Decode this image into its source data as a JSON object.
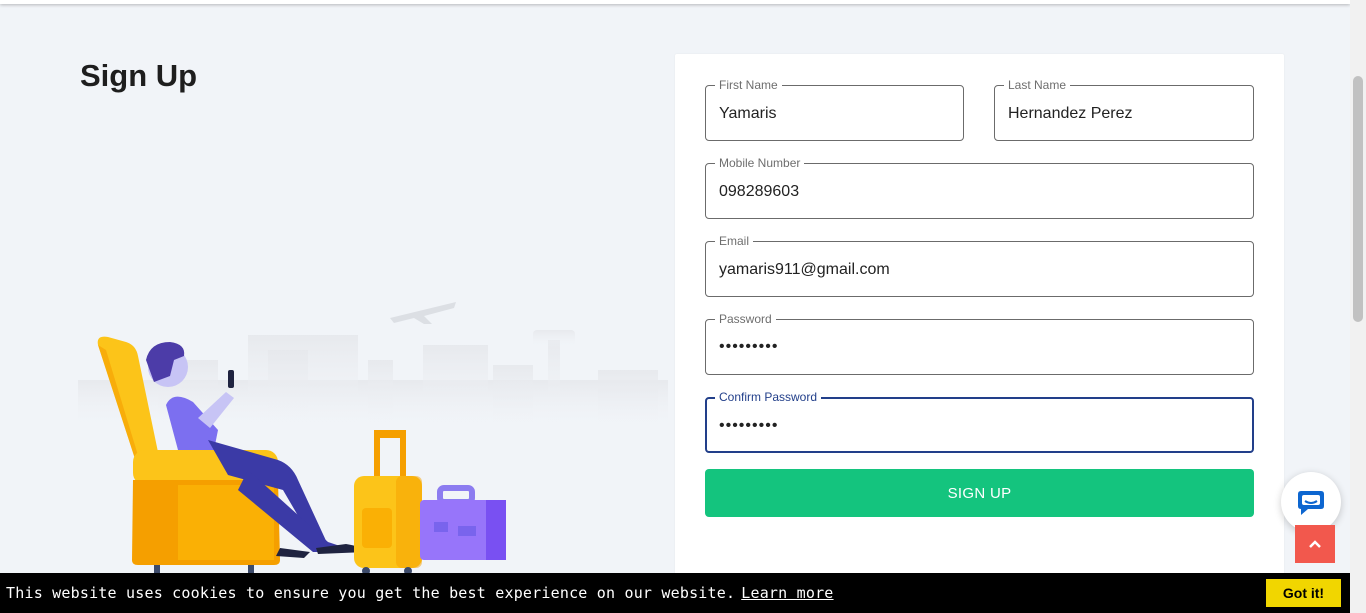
{
  "page": {
    "title": "Sign Up"
  },
  "form": {
    "first_name": {
      "label": "First Name",
      "value": "Yamaris"
    },
    "last_name": {
      "label": "Last Name",
      "value": "Hernandez Perez"
    },
    "mobile": {
      "label": "Mobile Number",
      "value": "098289603"
    },
    "email": {
      "label": "Email",
      "value": "yamaris911@gmail.com"
    },
    "password": {
      "label": "Password",
      "value": "•••••••••"
    },
    "confirm_password": {
      "label": "Confirm Password",
      "value": "•••••••••"
    },
    "submit_label": "SIGN UP"
  },
  "cookie_banner": {
    "message": "This website uses cookies to ensure you get the best experience on our website.",
    "link_label": "Learn more",
    "accept_label": "Got it!"
  },
  "icons": {
    "chat": "chat-bubble-icon",
    "scroll_top": "chevron-up-icon"
  },
  "colors": {
    "accent_green": "#14c47e",
    "focus_blue": "#223f8a",
    "scroll_top_red": "#f2584d",
    "cookie_yellow": "#f1d600"
  }
}
